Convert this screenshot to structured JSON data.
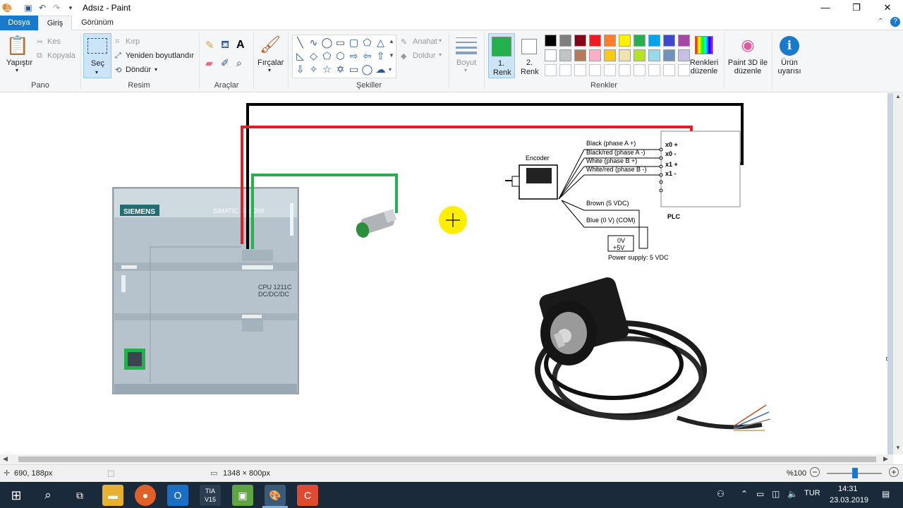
{
  "window": {
    "title": "Adsız - Paint",
    "minimize": "—",
    "maximize": "❐",
    "close": "✕"
  },
  "tabs": [
    "Dosya",
    "Giriş",
    "Görünüm"
  ],
  "ribbon": {
    "pano": {
      "label": "Pano",
      "paste": "Yapıştır",
      "cut": "Kes",
      "copy": "Kopyala"
    },
    "resim": {
      "label": "Resim",
      "select": "Seç",
      "crop": "Kırp",
      "resize": "Yeniden boyutlandır",
      "rotate": "Döndür"
    },
    "araclar": {
      "label": "Araçlar"
    },
    "brushes": "Fırçalar",
    "sekiller": {
      "label": "Şekiller",
      "outline": "Anahat",
      "fill": "Doldur"
    },
    "size": "Boyut",
    "color1": {
      "line1": "1.",
      "line2": "Renk",
      "hex": "#22b14c"
    },
    "color2": {
      "line1": "2.",
      "line2": "Renk",
      "hex": "#ffffff"
    },
    "renkler": {
      "label": "Renkler",
      "edit": "Renkleri düzenle",
      "palette_row1": [
        "#000000",
        "#7f7f7f",
        "#880015",
        "#ed1c24",
        "#ff7f27",
        "#fff200",
        "#22b14c",
        "#00a2e8",
        "#3f48cc",
        "#a349a4"
      ],
      "palette_row2": [
        "#ffffff",
        "#c3c3c3",
        "#b97a57",
        "#ffaec9",
        "#ffc90e",
        "#efe4b0",
        "#b5e61d",
        "#99d9ea",
        "#7092be",
        "#c8bfe7"
      ]
    },
    "paint3d": "Paint 3D ile düzenle",
    "product_alert": "Ürün uyarısı"
  },
  "canvas": {
    "plc_module": {
      "brand": "SIEMENS",
      "model": "SIMATIC S7-1200",
      "cpu": "CPU 1211C",
      "cpu_type": "DC/DC/DC"
    },
    "diagram": {
      "encoder_label": "Encoder",
      "plc_label": "PLC",
      "wires": [
        "Black (phase A +)",
        "Black/red (phase A -)",
        "White (phase B +)",
        "White/red (phase B -)"
      ],
      "terminals": [
        "x0 +",
        "x0 -",
        "x1 +",
        "x1 -"
      ],
      "brown": "Brown (5 VDC)",
      "blue": "Blue (0 V) (COM)",
      "ps_0v": "0V",
      "ps_5v": "+5V",
      "power_supply": "Power supply: 5 VDC"
    }
  },
  "status": {
    "cursor_pos": "690, 188px",
    "canvas_size": "1348 × 800px",
    "zoom": "%100"
  },
  "taskbar": {
    "language": "TUR",
    "time": "14:31",
    "date": "23.03.2019",
    "tia": "TIA V15"
  }
}
